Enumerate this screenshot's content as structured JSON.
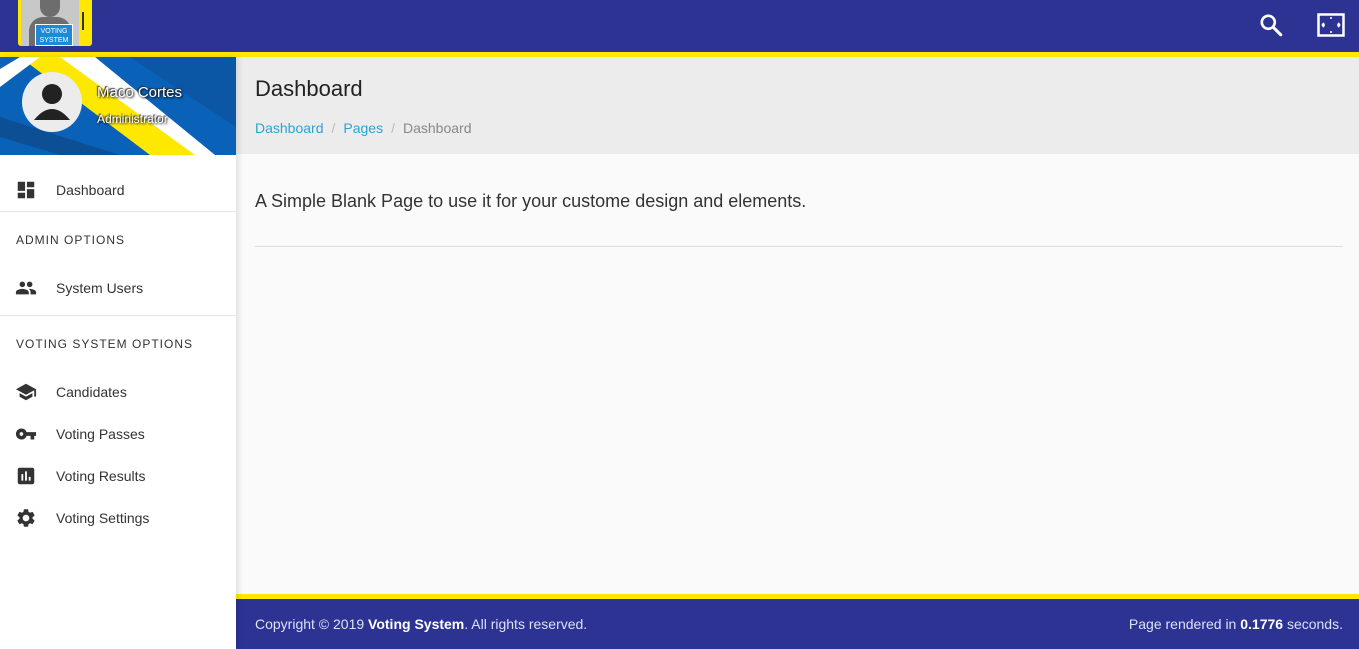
{
  "logo": {
    "text_line1": "VOTING",
    "text_line2": "SYSTEM"
  },
  "topbar": {
    "search_icon": "search-icon",
    "fullscreen_icon": "fullscreen-icon"
  },
  "user": {
    "name": "Maco Cortes",
    "role": "Administrator"
  },
  "sidebar": {
    "dashboard": "Dashboard",
    "admin_header": "ADMIN OPTIONS",
    "system_users": "System Users",
    "voting_header": "VOTING SYSTEM OPTIONS",
    "candidates": "Candidates",
    "voting_passes": "Voting Passes",
    "voting_results": "Voting Results",
    "voting_settings": "Voting Settings"
  },
  "header": {
    "title": "Dashboard",
    "breadcrumb": [
      "Dashboard",
      "Pages",
      "Dashboard"
    ],
    "breadcrumb_sep": "/"
  },
  "main": {
    "lead": "A Simple Blank Page to use it for your custome design and elements."
  },
  "footer": {
    "copyright_prefix": "Copyright © 2019",
    "brand": "Voting System",
    "copyright_suffix": ". All rights reserved.",
    "render_prefix": "Page rendered in",
    "render_time": "0.1776",
    "render_suffix": "seconds."
  },
  "colors": {
    "primary": "#2c3393",
    "accent": "#ffe800",
    "link": "#2aa3d6"
  }
}
